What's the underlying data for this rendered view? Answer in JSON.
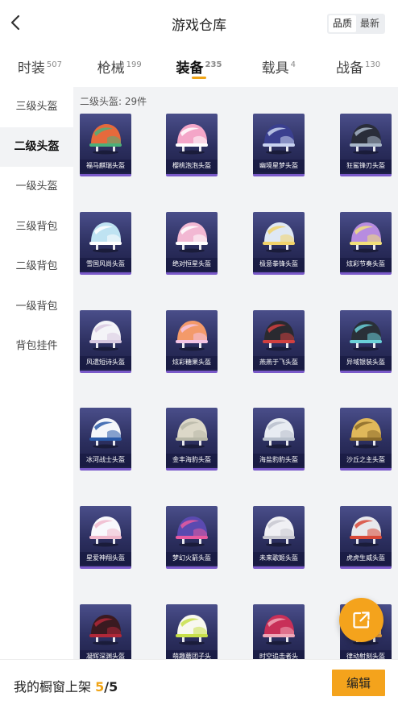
{
  "header": {
    "title": "游戏仓库",
    "sort_options": [
      {
        "label": "品质",
        "active": true
      },
      {
        "label": "最新",
        "active": false
      }
    ]
  },
  "tabs": [
    {
      "label": "时装",
      "count": "507",
      "active": false
    },
    {
      "label": "枪械",
      "count": "199",
      "active": false
    },
    {
      "label": "装备",
      "count": "235",
      "active": true
    },
    {
      "label": "载具",
      "count": "4",
      "active": false
    },
    {
      "label": "战备",
      "count": "130",
      "active": false
    }
  ],
  "sidebar": {
    "items": [
      {
        "label": "三级头盔",
        "active": false
      },
      {
        "label": "二级头盔",
        "active": true
      },
      {
        "label": "一级头盔",
        "active": false
      },
      {
        "label": "三级背包",
        "active": false
      },
      {
        "label": "二级背包",
        "active": false
      },
      {
        "label": "一级背包",
        "active": false
      },
      {
        "label": "背包挂件",
        "active": false
      }
    ]
  },
  "main": {
    "section_label": "二级头盔: 29件",
    "items": [
      {
        "name": "福马麒瑞头盔",
        "colors": [
          "#e66a3c",
          "#4bb07a"
        ]
      },
      {
        "name": "樱桃泡泡头盔",
        "colors": [
          "#f4a6c8",
          "#ffffff"
        ]
      },
      {
        "name": "幽境星梦头盔",
        "colors": [
          "#3a3f8f",
          "#c9d3f0"
        ]
      },
      {
        "name": "狂鲨锋刃头盔",
        "colors": [
          "#2a2d3a",
          "#a8b6c8"
        ]
      },
      {
        "name": "雪国风尚头盔",
        "colors": [
          "#bfe3f2",
          "#ffffff"
        ]
      },
      {
        "name": "绝对恒星头盔",
        "colors": [
          "#f2b8d3",
          "#ffffff"
        ]
      },
      {
        "name": "极意拳锋头盔",
        "colors": [
          "#dfe8f4",
          "#f2d36a"
        ]
      },
      {
        "name": "炫彩节奏头盔",
        "colors": [
          "#b78ce0",
          "#f2e07a"
        ]
      },
      {
        "name": "风遗短诗头盔",
        "colors": [
          "#f4f4f8",
          "#d8c8e0"
        ]
      },
      {
        "name": "炫彩糖果头盔",
        "colors": [
          "#f39a6a",
          "#f4c4e4"
        ]
      },
      {
        "name": "燕燕于飞头盔",
        "colors": [
          "#2a2a30",
          "#d04040"
        ]
      },
      {
        "name": "异域银装头盔",
        "colors": [
          "#2a3038",
          "#6ad0d8"
        ]
      },
      {
        "name": "冰河战士头盔",
        "colors": [
          "#f4f6fa",
          "#2a5aa8"
        ]
      },
      {
        "name": "金丰海豹头盔",
        "colors": [
          "#dcd8c8",
          "#b8b8a8"
        ]
      },
      {
        "name": "海盐豹豹头盔",
        "colors": [
          "#e8ecf2",
          "#b8c0cc"
        ]
      },
      {
        "name": "沙丘之主头盔",
        "colors": [
          "#e0b85a",
          "#8a6a2a"
        ]
      },
      {
        "name": "星爱神翔头盔",
        "colors": [
          "#f8f8fc",
          "#f0b8cc"
        ]
      },
      {
        "name": "梦幻火箭头盔",
        "colors": [
          "#5a4ab0",
          "#e85aa0"
        ]
      },
      {
        "name": "未来歌姬头盔",
        "colors": [
          "#f0f0f4",
          "#c8c8d0"
        ]
      },
      {
        "name": "虎虎生威头盔",
        "colors": [
          "#e8e8ec",
          "#d84838"
        ]
      },
      {
        "name": "凝辉深渊头盔",
        "colors": [
          "#3a1a20",
          "#b02838"
        ]
      },
      {
        "name": "萌趣蘑团子头",
        "colors": [
          "#f8f8f0",
          "#c8e04a"
        ]
      },
      {
        "name": "时空追击者头",
        "colors": [
          "#c83058",
          "#f0a8b8"
        ]
      },
      {
        "name": "律动射刻头盔",
        "colors": [
          "#f0d8a8",
          "#e8a040"
        ]
      }
    ]
  },
  "fab": {
    "icon": "share-external-icon"
  },
  "bottombar": {
    "showcase_label": "我的橱窗上架",
    "showcase_count": "5",
    "showcase_sep": "/",
    "showcase_total": "5",
    "edit_label": "编辑"
  },
  "colors": {
    "accent": "#f4a31c",
    "card_bg": "#2c2f5f",
    "card_border": "#7a59c9",
    "panel_bg": "#f2f3f5"
  }
}
